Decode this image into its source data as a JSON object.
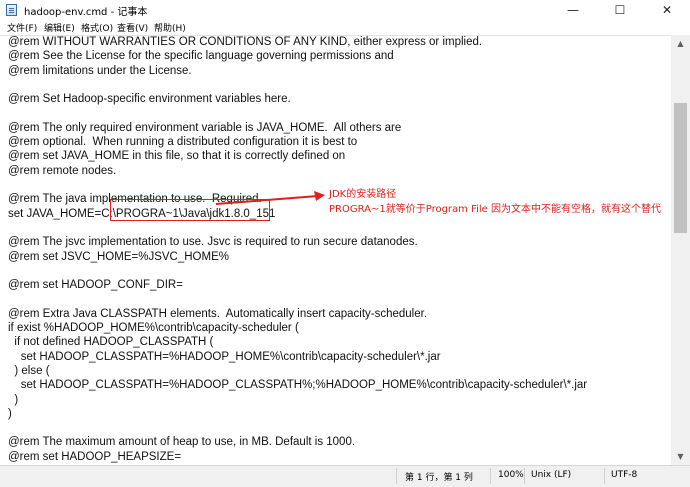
{
  "window": {
    "title": "hadoop-env.cmd - 记事本",
    "minimize": "—",
    "maximize": "☐",
    "close": "✕"
  },
  "menu": [
    "文件(F)",
    "编辑(E)",
    "格式(O)",
    "查看(V)",
    "帮助(H)"
  ],
  "lines": [
    "@rem WITHOUT WARRANTIES OR CONDITIONS OF ANY KIND, either express or implied.",
    "@rem See the License for the specific language governing permissions and",
    "@rem limitations under the License.",
    "",
    "@rem Set Hadoop-specific environment variables here.",
    "",
    "@rem The only required environment variable is JAVA_HOME.  All others are",
    "@rem optional.  When running a distributed configuration it is best to",
    "@rem set JAVA_HOME in this file, so that it is correctly defined on",
    "@rem remote nodes.",
    "",
    "@rem The java implementation to use.  Required.",
    "set JAVA_HOME=C:\\PROGRA~1\\Java\\jdk1.8.0_151",
    "",
    "@rem The jsvc implementation to use. Jsvc is required to run secure datanodes.",
    "@rem set JSVC_HOME=%JSVC_HOME%",
    "",
    "@rem set HADOOP_CONF_DIR=",
    "",
    "@rem Extra Java CLASSPATH elements.  Automatically insert capacity-scheduler.",
    "if exist %HADOOP_HOME%\\contrib\\capacity-scheduler (",
    "  if not defined HADOOP_CLASSPATH (",
    "    set HADOOP_CLASSPATH=%HADOOP_HOME%\\contrib\\capacity-scheduler\\*.jar",
    "  ) else (",
    "    set HADOOP_CLASSPATH=%HADOOP_CLASSPATH%;%HADOOP_HOME%\\contrib\\capacity-scheduler\\*.jar",
    "  )",
    ")",
    "",
    "@rem The maximum amount of heap to use, in MB. Default is 1000.",
    "@rem set HADOOP_HEAPSIZE="
  ],
  "annotation": {
    "line1": "JDK的安装路径",
    "line2": "PROGRA~1就等价于Program File 因为文本中不能有空格，就有这个替代",
    "color": "#e0201a"
  },
  "status": {
    "position": "第 1 行，第 1 列",
    "zoom": "100%",
    "eol": "Unix (LF)",
    "encoding": "UTF-8"
  }
}
